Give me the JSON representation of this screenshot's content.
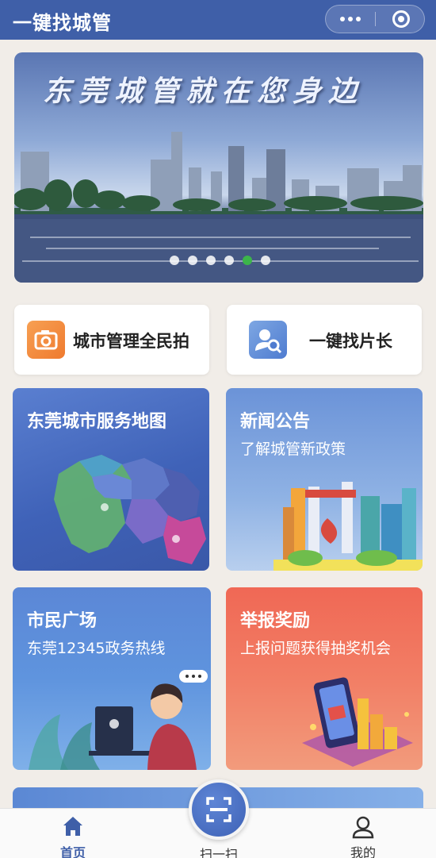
{
  "header": {
    "title": "一键找城管",
    "more_icon": "more-dots-icon",
    "close_icon": "target-close-icon"
  },
  "banner": {
    "title": "东莞城管就在您身边",
    "dots": 6,
    "active_dot": 5
  },
  "quick_actions": [
    {
      "label": "城市管理全民拍",
      "icon": "camera-icon",
      "color": "#ef7a2e"
    },
    {
      "label": "一键找片长",
      "icon": "person-search-icon",
      "color": "#4f7cd0"
    }
  ],
  "cards": {
    "map": {
      "title": "东莞城市服务地图"
    },
    "news": {
      "title": "新闻公告",
      "subtitle": "了解城管新政策"
    },
    "plaza": {
      "title": "市民广场",
      "subtitle": "东莞12345政务热线"
    },
    "report": {
      "title": "举报奖励",
      "subtitle": "上报问题获得抽奖机会"
    }
  },
  "tabbar": {
    "home": {
      "label": "首页",
      "icon": "home-icon"
    },
    "scan": {
      "label": "扫一扫",
      "icon": "scan-icon"
    },
    "me": {
      "label": "我的",
      "icon": "user-icon"
    }
  },
  "colors": {
    "brand": "#3f5fa8",
    "active_dot": "#3cb54a",
    "report": "#f06855"
  }
}
